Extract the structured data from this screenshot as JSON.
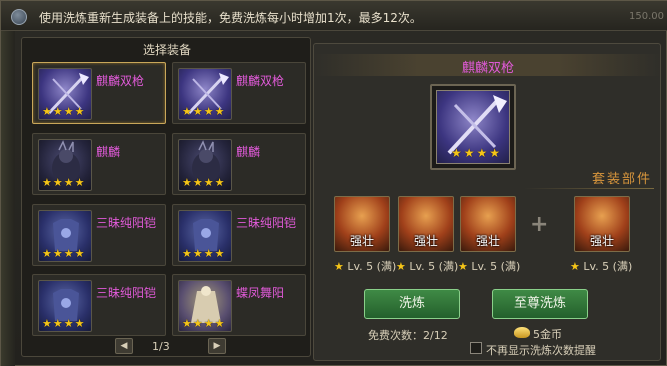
{
  "banner": {
    "text": "使用洗炼重新生成装备上的技能，免费洗炼每小时增加1次，最多12次。",
    "corner": "150.00"
  },
  "left_panel": {
    "title": "选择装备",
    "items": [
      {
        "name": "麒麟双枪",
        "icon": "dual-spear-icon",
        "stars": 4,
        "selected": true
      },
      {
        "name": "麒麟双枪",
        "icon": "dual-spear-icon",
        "stars": 4,
        "selected": false
      },
      {
        "name": "麒麟",
        "icon": "qilin-mount-icon",
        "stars": 4,
        "selected": false
      },
      {
        "name": "麒麟",
        "icon": "qilin-mount-icon",
        "stars": 4,
        "selected": false
      },
      {
        "name": "三昧纯阳铠",
        "icon": "armor-icon",
        "stars": 4,
        "selected": false
      },
      {
        "name": "三昧纯阳铠",
        "icon": "armor-icon",
        "stars": 4,
        "selected": false
      },
      {
        "name": "三昧纯阳铠",
        "icon": "armor-icon",
        "stars": 4,
        "selected": false
      },
      {
        "name": "蝶凤舞阳",
        "icon": "robe-icon",
        "stars": 4,
        "selected": false
      }
    ],
    "pager": {
      "prev": "◀",
      "next": "▶",
      "text": "1/3"
    }
  },
  "right_panel": {
    "equip_name": "麒麟双枪",
    "equip_stars": 4,
    "set_label": "套装部件",
    "parts": [
      {
        "label": "强壮",
        "level": "Lv. 5 (满)"
      },
      {
        "label": "强壮",
        "level": "Lv. 5 (满)"
      },
      {
        "label": "强壮",
        "level": "Lv. 5 (满)"
      },
      {
        "label": "强壮",
        "level": "Lv. 5 (满)"
      }
    ],
    "plus_symbol": "+",
    "refine_button": "洗炼",
    "supreme_button": "至尊洗炼",
    "free_count": "免费次数：2/12",
    "gold_cost": "5金币",
    "checkbox_label": "不再显示洗炼次数提醒"
  },
  "colors": {
    "item_name": "#e05ad8",
    "star": "#f5c518",
    "set_label": "#d7953c",
    "button_green": "#3f8a45"
  }
}
